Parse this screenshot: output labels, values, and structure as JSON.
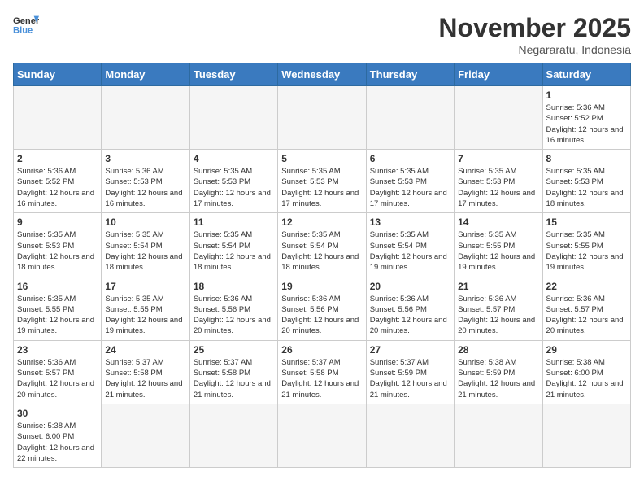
{
  "header": {
    "logo_general": "General",
    "logo_blue": "Blue",
    "month_year": "November 2025",
    "location": "Negararatu, Indonesia"
  },
  "days_of_week": [
    "Sunday",
    "Monday",
    "Tuesday",
    "Wednesday",
    "Thursday",
    "Friday",
    "Saturday"
  ],
  "weeks": [
    [
      {
        "day": "",
        "empty": true
      },
      {
        "day": "",
        "empty": true
      },
      {
        "day": "",
        "empty": true
      },
      {
        "day": "",
        "empty": true
      },
      {
        "day": "",
        "empty": true
      },
      {
        "day": "",
        "empty": true
      },
      {
        "day": "1",
        "sunrise": "5:36 AM",
        "sunset": "5:52 PM",
        "daylight": "12 hours and 16 minutes."
      }
    ],
    [
      {
        "day": "2",
        "sunrise": "5:36 AM",
        "sunset": "5:52 PM",
        "daylight": "12 hours and 16 minutes."
      },
      {
        "day": "3",
        "sunrise": "5:36 AM",
        "sunset": "5:53 PM",
        "daylight": "12 hours and 16 minutes."
      },
      {
        "day": "4",
        "sunrise": "5:35 AM",
        "sunset": "5:53 PM",
        "daylight": "12 hours and 17 minutes."
      },
      {
        "day": "5",
        "sunrise": "5:35 AM",
        "sunset": "5:53 PM",
        "daylight": "12 hours and 17 minutes."
      },
      {
        "day": "6",
        "sunrise": "5:35 AM",
        "sunset": "5:53 PM",
        "daylight": "12 hours and 17 minutes."
      },
      {
        "day": "7",
        "sunrise": "5:35 AM",
        "sunset": "5:53 PM",
        "daylight": "12 hours and 17 minutes."
      },
      {
        "day": "8",
        "sunrise": "5:35 AM",
        "sunset": "5:53 PM",
        "daylight": "12 hours and 18 minutes."
      }
    ],
    [
      {
        "day": "9",
        "sunrise": "5:35 AM",
        "sunset": "5:53 PM",
        "daylight": "12 hours and 18 minutes."
      },
      {
        "day": "10",
        "sunrise": "5:35 AM",
        "sunset": "5:54 PM",
        "daylight": "12 hours and 18 minutes."
      },
      {
        "day": "11",
        "sunrise": "5:35 AM",
        "sunset": "5:54 PM",
        "daylight": "12 hours and 18 minutes."
      },
      {
        "day": "12",
        "sunrise": "5:35 AM",
        "sunset": "5:54 PM",
        "daylight": "12 hours and 18 minutes."
      },
      {
        "day": "13",
        "sunrise": "5:35 AM",
        "sunset": "5:54 PM",
        "daylight": "12 hours and 19 minutes."
      },
      {
        "day": "14",
        "sunrise": "5:35 AM",
        "sunset": "5:55 PM",
        "daylight": "12 hours and 19 minutes."
      },
      {
        "day": "15",
        "sunrise": "5:35 AM",
        "sunset": "5:55 PM",
        "daylight": "12 hours and 19 minutes."
      }
    ],
    [
      {
        "day": "16",
        "sunrise": "5:35 AM",
        "sunset": "5:55 PM",
        "daylight": "12 hours and 19 minutes."
      },
      {
        "day": "17",
        "sunrise": "5:35 AM",
        "sunset": "5:55 PM",
        "daylight": "12 hours and 19 minutes."
      },
      {
        "day": "18",
        "sunrise": "5:36 AM",
        "sunset": "5:56 PM",
        "daylight": "12 hours and 20 minutes."
      },
      {
        "day": "19",
        "sunrise": "5:36 AM",
        "sunset": "5:56 PM",
        "daylight": "12 hours and 20 minutes."
      },
      {
        "day": "20",
        "sunrise": "5:36 AM",
        "sunset": "5:56 PM",
        "daylight": "12 hours and 20 minutes."
      },
      {
        "day": "21",
        "sunrise": "5:36 AM",
        "sunset": "5:57 PM",
        "daylight": "12 hours and 20 minutes."
      },
      {
        "day": "22",
        "sunrise": "5:36 AM",
        "sunset": "5:57 PM",
        "daylight": "12 hours and 20 minutes."
      }
    ],
    [
      {
        "day": "23",
        "sunrise": "5:36 AM",
        "sunset": "5:57 PM",
        "daylight": "12 hours and 20 minutes."
      },
      {
        "day": "24",
        "sunrise": "5:37 AM",
        "sunset": "5:58 PM",
        "daylight": "12 hours and 21 minutes."
      },
      {
        "day": "25",
        "sunrise": "5:37 AM",
        "sunset": "5:58 PM",
        "daylight": "12 hours and 21 minutes."
      },
      {
        "day": "26",
        "sunrise": "5:37 AM",
        "sunset": "5:58 PM",
        "daylight": "12 hours and 21 minutes."
      },
      {
        "day": "27",
        "sunrise": "5:37 AM",
        "sunset": "5:59 PM",
        "daylight": "12 hours and 21 minutes."
      },
      {
        "day": "28",
        "sunrise": "5:38 AM",
        "sunset": "5:59 PM",
        "daylight": "12 hours and 21 minutes."
      },
      {
        "day": "29",
        "sunrise": "5:38 AM",
        "sunset": "6:00 PM",
        "daylight": "12 hours and 21 minutes."
      }
    ],
    [
      {
        "day": "30",
        "sunrise": "5:38 AM",
        "sunset": "6:00 PM",
        "daylight": "12 hours and 22 minutes."
      },
      {
        "day": "",
        "empty": true
      },
      {
        "day": "",
        "empty": true
      },
      {
        "day": "",
        "empty": true
      },
      {
        "day": "",
        "empty": true
      },
      {
        "day": "",
        "empty": true
      },
      {
        "day": "",
        "empty": true
      }
    ]
  ]
}
